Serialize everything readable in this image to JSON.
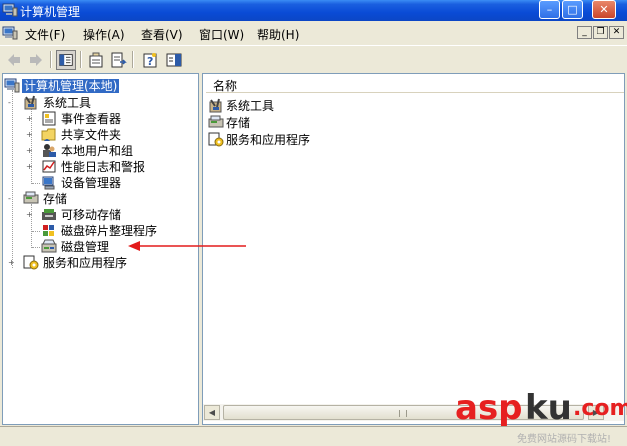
{
  "window": {
    "title": "计算机管理",
    "buttons": {
      "minimize": "–",
      "maximize": "□",
      "close": "✕"
    }
  },
  "menubar": {
    "items": [
      {
        "label": "文件(F)"
      },
      {
        "label": "操作(A)"
      },
      {
        "label": "查看(V)"
      },
      {
        "label": "窗口(W)"
      },
      {
        "label": "帮助(H)"
      }
    ],
    "mdi_buttons": {
      "minimize": "_",
      "restore": "❐",
      "close": "✕"
    }
  },
  "toolbar": {
    "icons": [
      "back-arrow-icon",
      "forward-arrow-icon",
      "show-hide-tree-icon",
      "properties-icon",
      "export-list-icon",
      "help-icon",
      "console-tree-icon"
    ]
  },
  "tree": {
    "root": {
      "label": "计算机管理(本地)",
      "icon": "computer-management-icon",
      "expander": "-"
    },
    "groups": [
      {
        "label": "系统工具",
        "icon": "system-tools-icon",
        "expander": "-",
        "children": [
          {
            "label": "事件查看器",
            "icon": "event-viewer-icon",
            "expander": "+"
          },
          {
            "label": "共享文件夹",
            "icon": "shared-folders-icon",
            "expander": "+"
          },
          {
            "label": "本地用户和组",
            "icon": "local-users-icon",
            "expander": "+"
          },
          {
            "label": "性能日志和警报",
            "icon": "performance-logs-icon",
            "expander": "+"
          },
          {
            "label": "设备管理器",
            "icon": "device-manager-icon",
            "expander": ""
          }
        ]
      },
      {
        "label": "存储",
        "icon": "storage-icon",
        "expander": "-",
        "children": [
          {
            "label": "可移动存储",
            "icon": "removable-storage-icon",
            "expander": "+"
          },
          {
            "label": "磁盘碎片整理程序",
            "icon": "disk-defrag-icon",
            "expander": ""
          },
          {
            "label": "磁盘管理",
            "icon": "disk-management-icon",
            "expander": ""
          }
        ]
      },
      {
        "label": "服务和应用程序",
        "icon": "services-apps-icon",
        "expander": "+",
        "children": []
      }
    ]
  },
  "list": {
    "column_header": "名称",
    "items": [
      {
        "label": "系统工具",
        "icon": "system-tools-icon"
      },
      {
        "label": "存储",
        "icon": "storage-icon"
      },
      {
        "label": "服务和应用程序",
        "icon": "services-apps-icon"
      }
    ],
    "scroll_left": "◀",
    "scroll_right": "▶"
  },
  "annotation": {
    "color": "#e31b1b",
    "points_to": "磁盘管理"
  },
  "watermark": {
    "brand_asp": "asp",
    "brand_ku": "ku",
    "brand_dotcom": ".com",
    "sub": "免费网站源码下载站!",
    "colors": {
      "red": "#e62020",
      "dark": "#333333"
    }
  },
  "colors": {
    "title_blue": "#0a4bd6",
    "selection": "#316ac5",
    "chrome": "#ece9d8"
  }
}
